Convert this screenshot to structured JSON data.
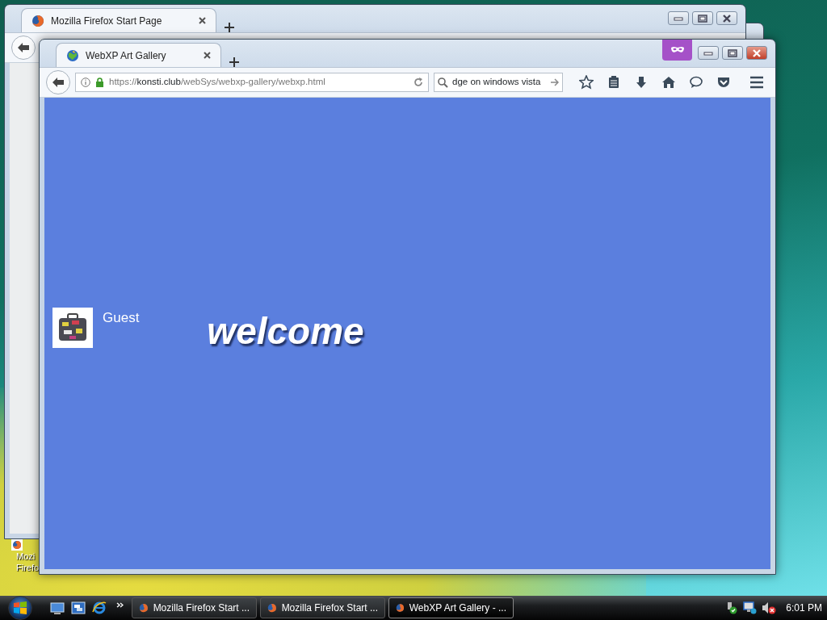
{
  "desktop": {
    "icons": [
      {
        "label_lines": [
          "Mozi",
          "Firefo"
        ]
      }
    ]
  },
  "windows": [
    {
      "active": false,
      "private": false,
      "tabs": [
        {
          "title": "Mozilla Firefox Start Page",
          "selected": true
        }
      ]
    },
    {
      "active": true,
      "private": true,
      "tabs": [
        {
          "title": "WebXP Art Gallery",
          "selected": true
        }
      ],
      "url": {
        "scheme": "https://",
        "host": "konsti.club",
        "path": "/webSys/webxp-gallery/webxp.html"
      },
      "search": {
        "value": "dge on windows vista"
      },
      "page": {
        "user": "Guest",
        "heading": "welcome"
      }
    }
  ],
  "taskbar": {
    "tasks": [
      {
        "label": "Mozilla Firefox Start ...",
        "selected": false
      },
      {
        "label": "Mozilla Firefox Start ...",
        "selected": false
      },
      {
        "label": "WebXP Art Gallery - ...",
        "selected": true
      }
    ],
    "clock": "6:01 PM"
  }
}
